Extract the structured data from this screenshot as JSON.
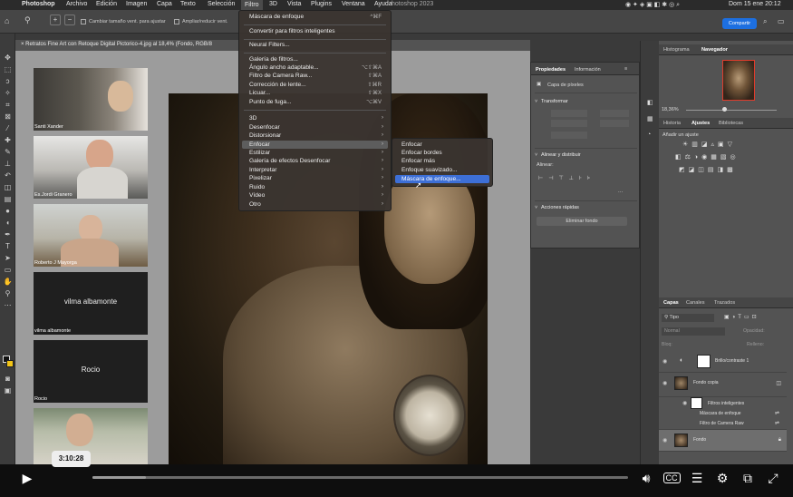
{
  "menubar": {
    "apple": "",
    "app": "Photoshop",
    "items": [
      "Archivo",
      "Edición",
      "Imagen",
      "Capa",
      "Texto",
      "Selección",
      "Filtro",
      "3D",
      "Vista",
      "Plugins",
      "Ventana",
      "Ayuda"
    ],
    "active": "Filtro",
    "window_title": "hotoshop 2023",
    "clock": "Dom 15 ene  20:12"
  },
  "options": {
    "checkbox1": "Cambiar tamaño vent. para ajustar",
    "checkbox2": "Ampliar/reducir vent.",
    "share": "Compartir"
  },
  "document": {
    "tab_title": "Retratos Fine Art con Retoque Digital Pictorico-4.jpg al 18,4% (Fondo, RGB/8"
  },
  "video_tiles": [
    {
      "name": "Santi Xander",
      "center": ""
    },
    {
      "name": "Es.Jordi Granero",
      "center": ""
    },
    {
      "name": "Roberto J Mayorga",
      "center": ""
    },
    {
      "name": "vilma albamonte",
      "center": "vilma albamonte"
    },
    {
      "name": "Rocio",
      "center": "Rocio"
    },
    {
      "name": "",
      "center": ""
    }
  ],
  "filter_menu": {
    "items": [
      {
        "label": "Máscara de enfoque",
        "shortcut": "^⌘F"
      },
      {
        "label": "Convertir para filtros inteligentes",
        "shortcut": ""
      },
      {
        "label": "Neural Filters...",
        "shortcut": ""
      },
      {
        "label": "Galería de filtros...",
        "shortcut": ""
      },
      {
        "label": "Ángulo ancho adaptable...",
        "shortcut": "⌥⇧⌘A"
      },
      {
        "label": "Filtro de Camera Raw...",
        "shortcut": "⇧⌘A"
      },
      {
        "label": "Corrección de lente...",
        "shortcut": "⇧⌘R"
      },
      {
        "label": "Licuar...",
        "shortcut": "⇧⌘X"
      },
      {
        "label": "Punto de fuga...",
        "shortcut": "⌥⌘V"
      },
      {
        "label": "3D",
        "shortcut": ""
      },
      {
        "label": "Desenfocar",
        "shortcut": ""
      },
      {
        "label": "Distorsionar",
        "shortcut": ""
      },
      {
        "label": "Enfocar",
        "shortcut": ""
      },
      {
        "label": "Estilizar",
        "shortcut": ""
      },
      {
        "label": "Galería de efectos Desenfocar",
        "shortcut": ""
      },
      {
        "label": "Interpretar",
        "shortcut": ""
      },
      {
        "label": "Pixelizar",
        "shortcut": ""
      },
      {
        "label": "Ruido",
        "shortcut": ""
      },
      {
        "label": "Vídeo",
        "shortcut": ""
      },
      {
        "label": "Otro",
        "shortcut": ""
      }
    ],
    "highlighted": "Enfocar"
  },
  "enfocar_submenu": {
    "items": [
      "Enfocar",
      "Enfocar bordes",
      "Enfocar más",
      "Enfoque suavizado...",
      "Máscara de enfoque..."
    ],
    "selected": "Máscara de enfoque..."
  },
  "properties": {
    "tabs": [
      "Propiedades",
      "Información"
    ],
    "layer_kind": "Capa de píxeles",
    "transform": "Transformar",
    "align": "Alinear y distribuir",
    "align_sub": "Alinear:",
    "quick": "Acciones rápidas",
    "remove_bg": "Eliminar fondo"
  },
  "right_panel": {
    "tabs_top": [
      "Histograma",
      "Navegador"
    ],
    "zoom": "18,36%",
    "tabs_mid": [
      "Historia",
      "Ajustes",
      "Bibliotecas"
    ],
    "adjust_label": "Añadir un ajuste",
    "tabs_layers": [
      "Capas",
      "Canales",
      "Trazados"
    ],
    "kind_filter": "Tipo",
    "blend": "Normal",
    "opacity_label": "Opacidad:",
    "lock_label": "Bloq:",
    "fill_label": "Relleno:",
    "layers": [
      {
        "name": "Brillo/contraste 1"
      },
      {
        "name": "Fondo copia"
      },
      {
        "name": "Filtros inteligentes"
      },
      {
        "name": "Máscara de enfoque"
      },
      {
        "name": "Filtro de Camera Raw"
      },
      {
        "name": "Fondo"
      }
    ]
  },
  "player": {
    "time": "3:10:28",
    "progress": 0.1
  }
}
